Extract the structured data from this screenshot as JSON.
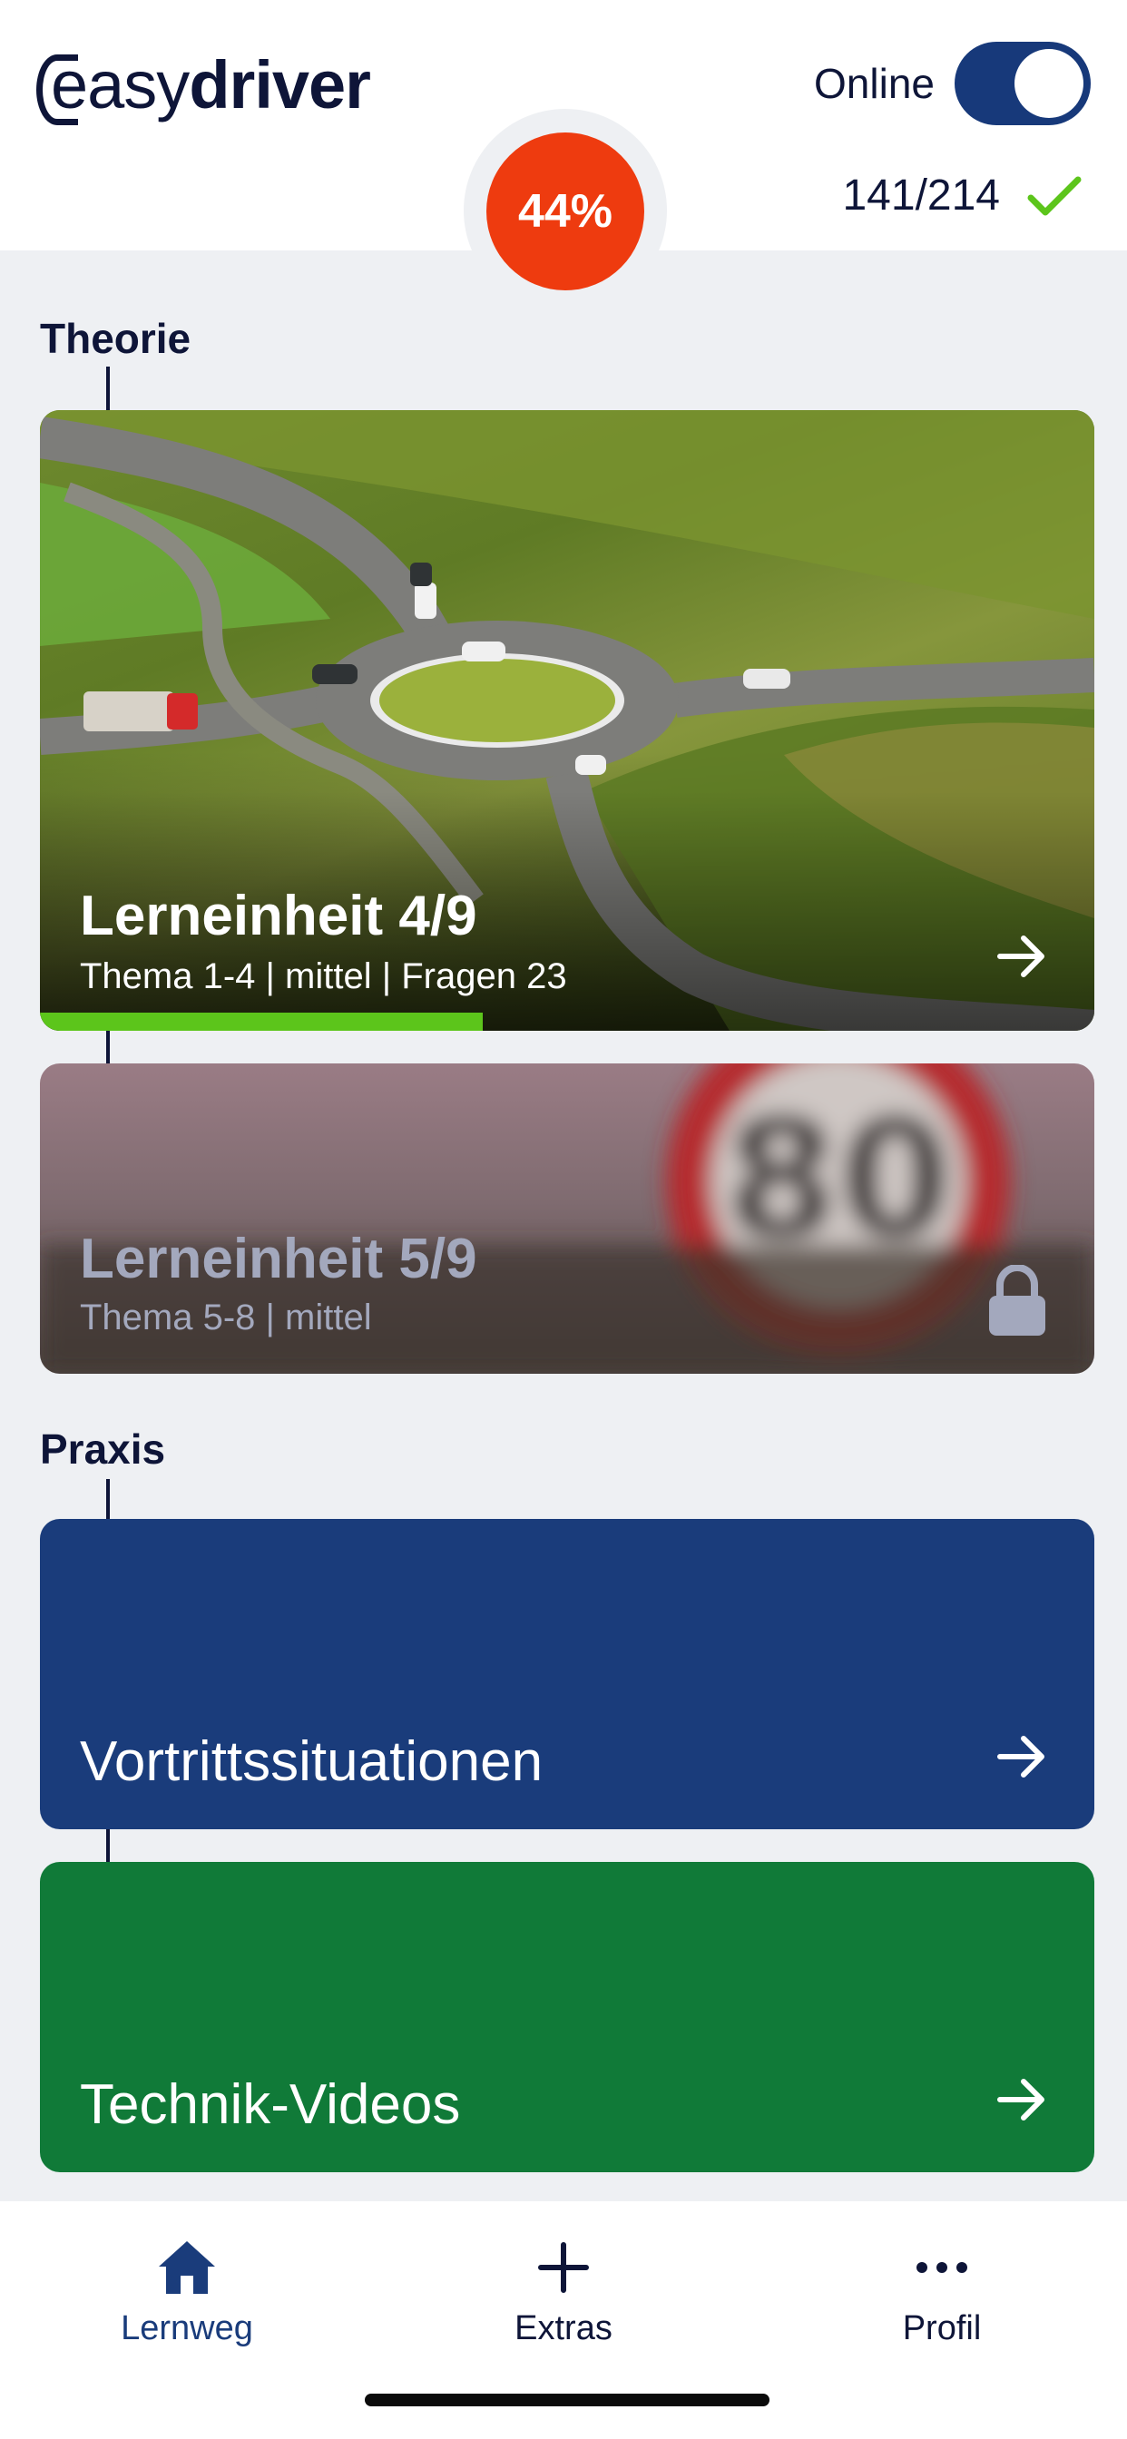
{
  "header": {
    "logo_easy": "easy",
    "logo_driver": "driver",
    "online_label": "Online",
    "online_toggle_state": "on",
    "progress_percent": "44%",
    "counter": "141/214"
  },
  "theorie": {
    "title": "Theorie",
    "cards": [
      {
        "title": "Lerneinheit 4/9",
        "subtitle": "Thema 1-4 | mittel | Fragen 23",
        "progress_fraction": 0.42,
        "icon": "arrow-right-icon"
      },
      {
        "title": "Lerneinheit 5/9",
        "subtitle": "Thema 5-8 | mittel",
        "locked": true,
        "icon": "lock-icon"
      }
    ]
  },
  "praxis": {
    "title": "Praxis",
    "cards": [
      {
        "title": "Vortrittssituationen",
        "icon": "arrow-right-icon",
        "color": "#1a3c7b"
      },
      {
        "title": "Technik-Videos",
        "icon": "arrow-right-icon",
        "color": "#107a38"
      }
    ]
  },
  "nav": {
    "items": [
      {
        "label": "Lernweg",
        "icon": "home-icon",
        "active": true
      },
      {
        "label": "Extras",
        "icon": "plus-icon",
        "active": false
      },
      {
        "label": "Profil",
        "icon": "more-icon",
        "active": false
      }
    ]
  },
  "colors": {
    "navy": "#0e1538",
    "accent_blue": "#1a3c7b",
    "accent_green": "#107a38",
    "progress_red": "#ee3b0f",
    "progress_green": "#5cc51b"
  }
}
